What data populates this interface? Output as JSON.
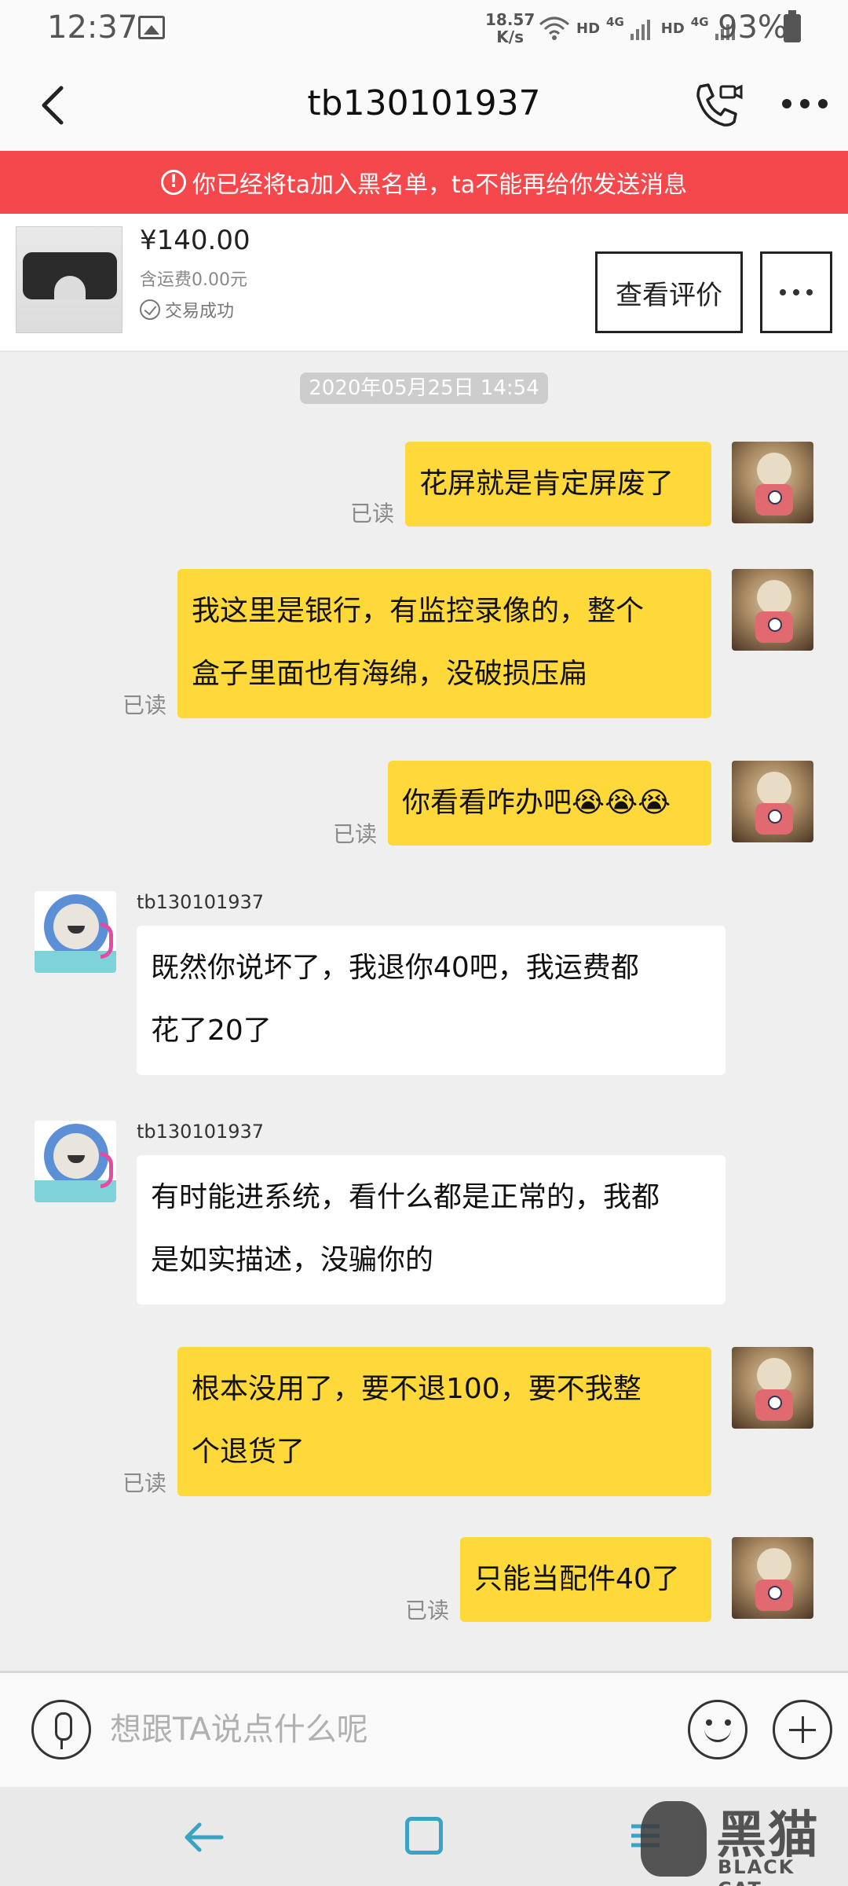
{
  "status_bar": {
    "time": "12:37",
    "speed_value": "18.57",
    "speed_unit": "K/s",
    "hd1": "HD",
    "net1": "4G",
    "hd2": "HD",
    "net2": "4G",
    "battery": "93%"
  },
  "header": {
    "title": "tb130101937"
  },
  "banner": {
    "icon": "!",
    "text": "你已经将ta加入黑名单，ta不能再给你发送消息"
  },
  "product": {
    "price": "¥140.00",
    "shipping": "含运费0.00元",
    "status": "交易成功",
    "review_button": "查看评价"
  },
  "chat": {
    "timestamp": "2020年05月25日 14:54",
    "read_label": "已读",
    "messages": [
      {
        "from": "me",
        "lines": [
          "花屏就是肯定屏废了"
        ]
      },
      {
        "from": "me",
        "lines": [
          "我这里是银行，有监控录像的，整个",
          "盒子里面也有海绵，没破损压扁"
        ]
      },
      {
        "from": "me",
        "lines": [
          "你看看咋办吧😭😭😭"
        ]
      },
      {
        "from": "other",
        "sender": "tb130101937",
        "lines": [
          "既然你说坏了，我退你40吧，我运费都",
          "花了20了"
        ]
      },
      {
        "from": "other",
        "sender": "tb130101937",
        "lines": [
          "有时能进系统，看什么都是正常的，我都",
          "是如实描述，没骗你的"
        ]
      },
      {
        "from": "me",
        "lines": [
          "根本没用了，要不退100，要不我整",
          "个退货了"
        ]
      },
      {
        "from": "me",
        "lines": [
          "只能当配件40了"
        ]
      }
    ]
  },
  "input": {
    "placeholder": "想跟TA说点什么呢"
  },
  "watermark": {
    "big": "黑猫",
    "small": "BLACK CAT"
  },
  "colors": {
    "banner": "#f5484d",
    "my_bubble": "#ffd83a",
    "other_bubble": "#ffffff",
    "background": "#efefef"
  }
}
